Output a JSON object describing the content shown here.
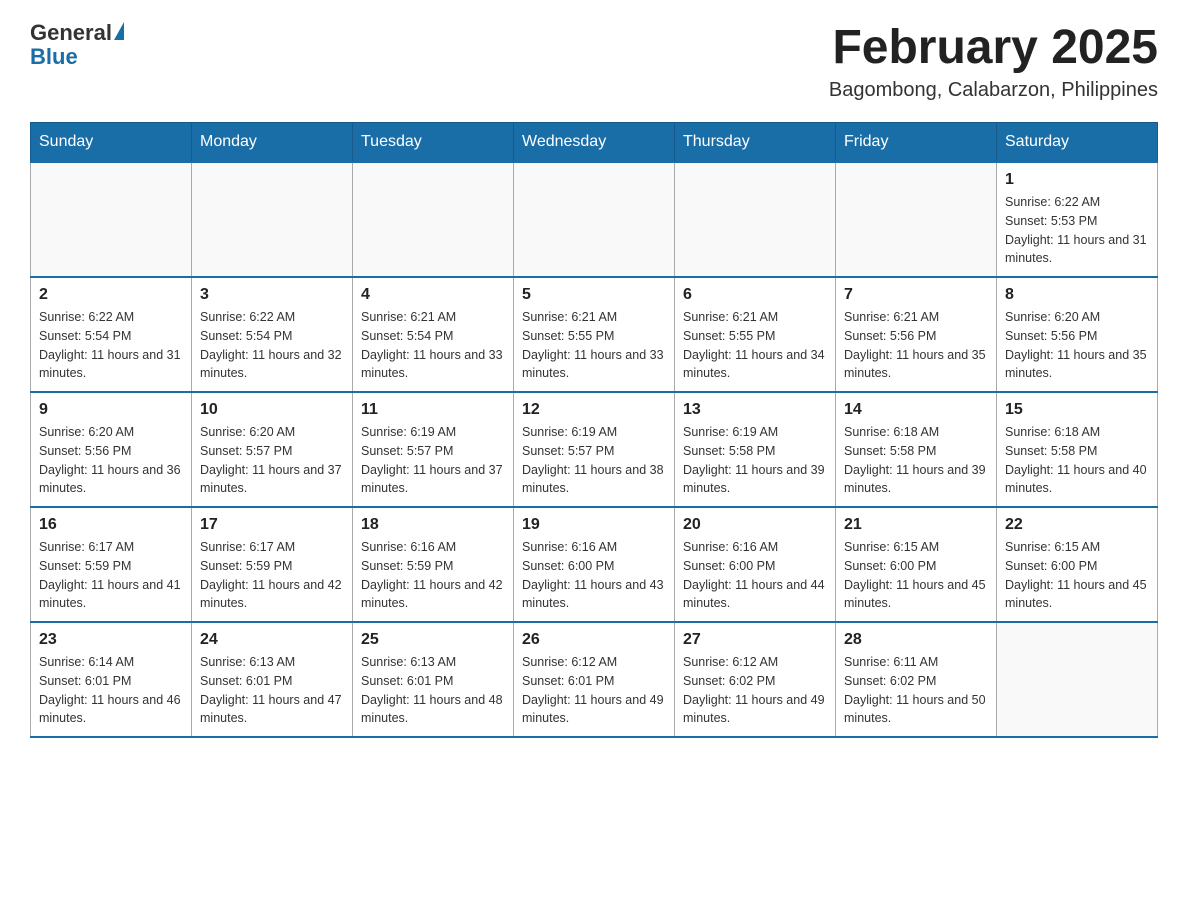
{
  "logo": {
    "general": "General",
    "blue": "Blue"
  },
  "title": "February 2025",
  "subtitle": "Bagombong, Calabarzon, Philippines",
  "days_of_week": [
    "Sunday",
    "Monday",
    "Tuesday",
    "Wednesday",
    "Thursday",
    "Friday",
    "Saturday"
  ],
  "weeks": [
    [
      {
        "day": "",
        "info": ""
      },
      {
        "day": "",
        "info": ""
      },
      {
        "day": "",
        "info": ""
      },
      {
        "day": "",
        "info": ""
      },
      {
        "day": "",
        "info": ""
      },
      {
        "day": "",
        "info": ""
      },
      {
        "day": "1",
        "info": "Sunrise: 6:22 AM\nSunset: 5:53 PM\nDaylight: 11 hours and 31 minutes."
      }
    ],
    [
      {
        "day": "2",
        "info": "Sunrise: 6:22 AM\nSunset: 5:54 PM\nDaylight: 11 hours and 31 minutes."
      },
      {
        "day": "3",
        "info": "Sunrise: 6:22 AM\nSunset: 5:54 PM\nDaylight: 11 hours and 32 minutes."
      },
      {
        "day": "4",
        "info": "Sunrise: 6:21 AM\nSunset: 5:54 PM\nDaylight: 11 hours and 33 minutes."
      },
      {
        "day": "5",
        "info": "Sunrise: 6:21 AM\nSunset: 5:55 PM\nDaylight: 11 hours and 33 minutes."
      },
      {
        "day": "6",
        "info": "Sunrise: 6:21 AM\nSunset: 5:55 PM\nDaylight: 11 hours and 34 minutes."
      },
      {
        "day": "7",
        "info": "Sunrise: 6:21 AM\nSunset: 5:56 PM\nDaylight: 11 hours and 35 minutes."
      },
      {
        "day": "8",
        "info": "Sunrise: 6:20 AM\nSunset: 5:56 PM\nDaylight: 11 hours and 35 minutes."
      }
    ],
    [
      {
        "day": "9",
        "info": "Sunrise: 6:20 AM\nSunset: 5:56 PM\nDaylight: 11 hours and 36 minutes."
      },
      {
        "day": "10",
        "info": "Sunrise: 6:20 AM\nSunset: 5:57 PM\nDaylight: 11 hours and 37 minutes."
      },
      {
        "day": "11",
        "info": "Sunrise: 6:19 AM\nSunset: 5:57 PM\nDaylight: 11 hours and 37 minutes."
      },
      {
        "day": "12",
        "info": "Sunrise: 6:19 AM\nSunset: 5:57 PM\nDaylight: 11 hours and 38 minutes."
      },
      {
        "day": "13",
        "info": "Sunrise: 6:19 AM\nSunset: 5:58 PM\nDaylight: 11 hours and 39 minutes."
      },
      {
        "day": "14",
        "info": "Sunrise: 6:18 AM\nSunset: 5:58 PM\nDaylight: 11 hours and 39 minutes."
      },
      {
        "day": "15",
        "info": "Sunrise: 6:18 AM\nSunset: 5:58 PM\nDaylight: 11 hours and 40 minutes."
      }
    ],
    [
      {
        "day": "16",
        "info": "Sunrise: 6:17 AM\nSunset: 5:59 PM\nDaylight: 11 hours and 41 minutes."
      },
      {
        "day": "17",
        "info": "Sunrise: 6:17 AM\nSunset: 5:59 PM\nDaylight: 11 hours and 42 minutes."
      },
      {
        "day": "18",
        "info": "Sunrise: 6:16 AM\nSunset: 5:59 PM\nDaylight: 11 hours and 42 minutes."
      },
      {
        "day": "19",
        "info": "Sunrise: 6:16 AM\nSunset: 6:00 PM\nDaylight: 11 hours and 43 minutes."
      },
      {
        "day": "20",
        "info": "Sunrise: 6:16 AM\nSunset: 6:00 PM\nDaylight: 11 hours and 44 minutes."
      },
      {
        "day": "21",
        "info": "Sunrise: 6:15 AM\nSunset: 6:00 PM\nDaylight: 11 hours and 45 minutes."
      },
      {
        "day": "22",
        "info": "Sunrise: 6:15 AM\nSunset: 6:00 PM\nDaylight: 11 hours and 45 minutes."
      }
    ],
    [
      {
        "day": "23",
        "info": "Sunrise: 6:14 AM\nSunset: 6:01 PM\nDaylight: 11 hours and 46 minutes."
      },
      {
        "day": "24",
        "info": "Sunrise: 6:13 AM\nSunset: 6:01 PM\nDaylight: 11 hours and 47 minutes."
      },
      {
        "day": "25",
        "info": "Sunrise: 6:13 AM\nSunset: 6:01 PM\nDaylight: 11 hours and 48 minutes."
      },
      {
        "day": "26",
        "info": "Sunrise: 6:12 AM\nSunset: 6:01 PM\nDaylight: 11 hours and 49 minutes."
      },
      {
        "day": "27",
        "info": "Sunrise: 6:12 AM\nSunset: 6:02 PM\nDaylight: 11 hours and 49 minutes."
      },
      {
        "day": "28",
        "info": "Sunrise: 6:11 AM\nSunset: 6:02 PM\nDaylight: 11 hours and 50 minutes."
      },
      {
        "day": "",
        "info": ""
      }
    ]
  ]
}
